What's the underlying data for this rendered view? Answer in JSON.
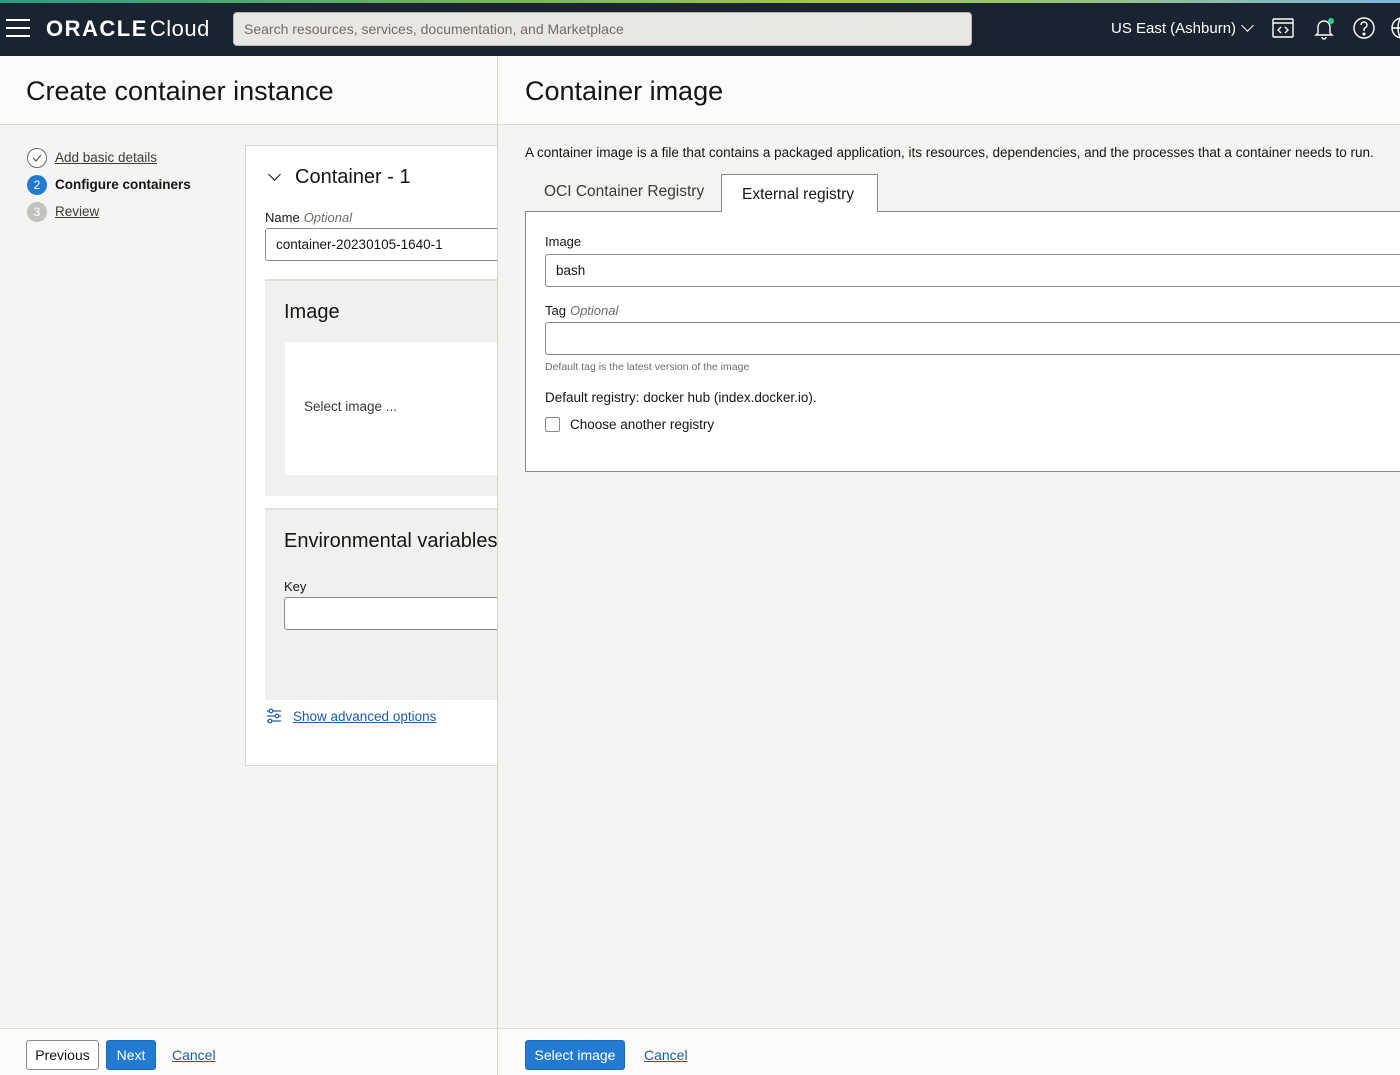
{
  "topbar": {
    "brand": "ORACLE",
    "product": "Cloud",
    "search_placeholder": "Search resources, services, documentation, and Marketplace",
    "region": "US East (Ashburn)",
    "icons": [
      "hamburger-menu-icon",
      "code-editor-icon",
      "notifications-bell-icon",
      "help-icon",
      "globe-icon"
    ],
    "accent_colors": [
      "#2e9a83",
      "#a5c93b",
      "#7fb8e0"
    ]
  },
  "page": {
    "title": "Create container instance",
    "steps": [
      {
        "number": "1",
        "label": "Add basic details",
        "state": "done"
      },
      {
        "number": "2",
        "label": "Configure containers",
        "state": "active"
      },
      {
        "number": "3",
        "label": "Review",
        "state": "todo"
      }
    ],
    "container_card": {
      "title": "Container - 1",
      "name_label": "Name",
      "optional": "Optional",
      "name_value": "container-20230105-1640-1",
      "image_heading": "Image",
      "select_image_text": "Select image ...",
      "env_heading": "Environmental variables",
      "key_label": "Key",
      "advanced_link": "Show advanced options"
    },
    "footer": {
      "previous": "Previous",
      "next": "Next",
      "cancel": "Cancel"
    }
  },
  "panel": {
    "title": "Container image",
    "description": "A container image is a file that contains a packaged application, its resources, dependencies, and the processes that a container needs to run.",
    "tabs": [
      {
        "label": "OCI Container Registry",
        "selected": false
      },
      {
        "label": "External registry",
        "selected": true
      }
    ],
    "image_label": "Image",
    "image_value": "bash",
    "tag_label": "Tag",
    "optional": "Optional",
    "tag_value": "",
    "tag_help": "Default tag is the latest version of the image",
    "default_registry": "Default registry: docker hub (index.docker.io).",
    "checkbox_label": "Choose another registry",
    "checkbox_checked": false,
    "footer": {
      "select_image": "Select image",
      "cancel": "Cancel"
    }
  },
  "colors": {
    "topbar_bg": "#1a2430",
    "primary_button": "#227bd1",
    "link": "#1e5ba8"
  }
}
